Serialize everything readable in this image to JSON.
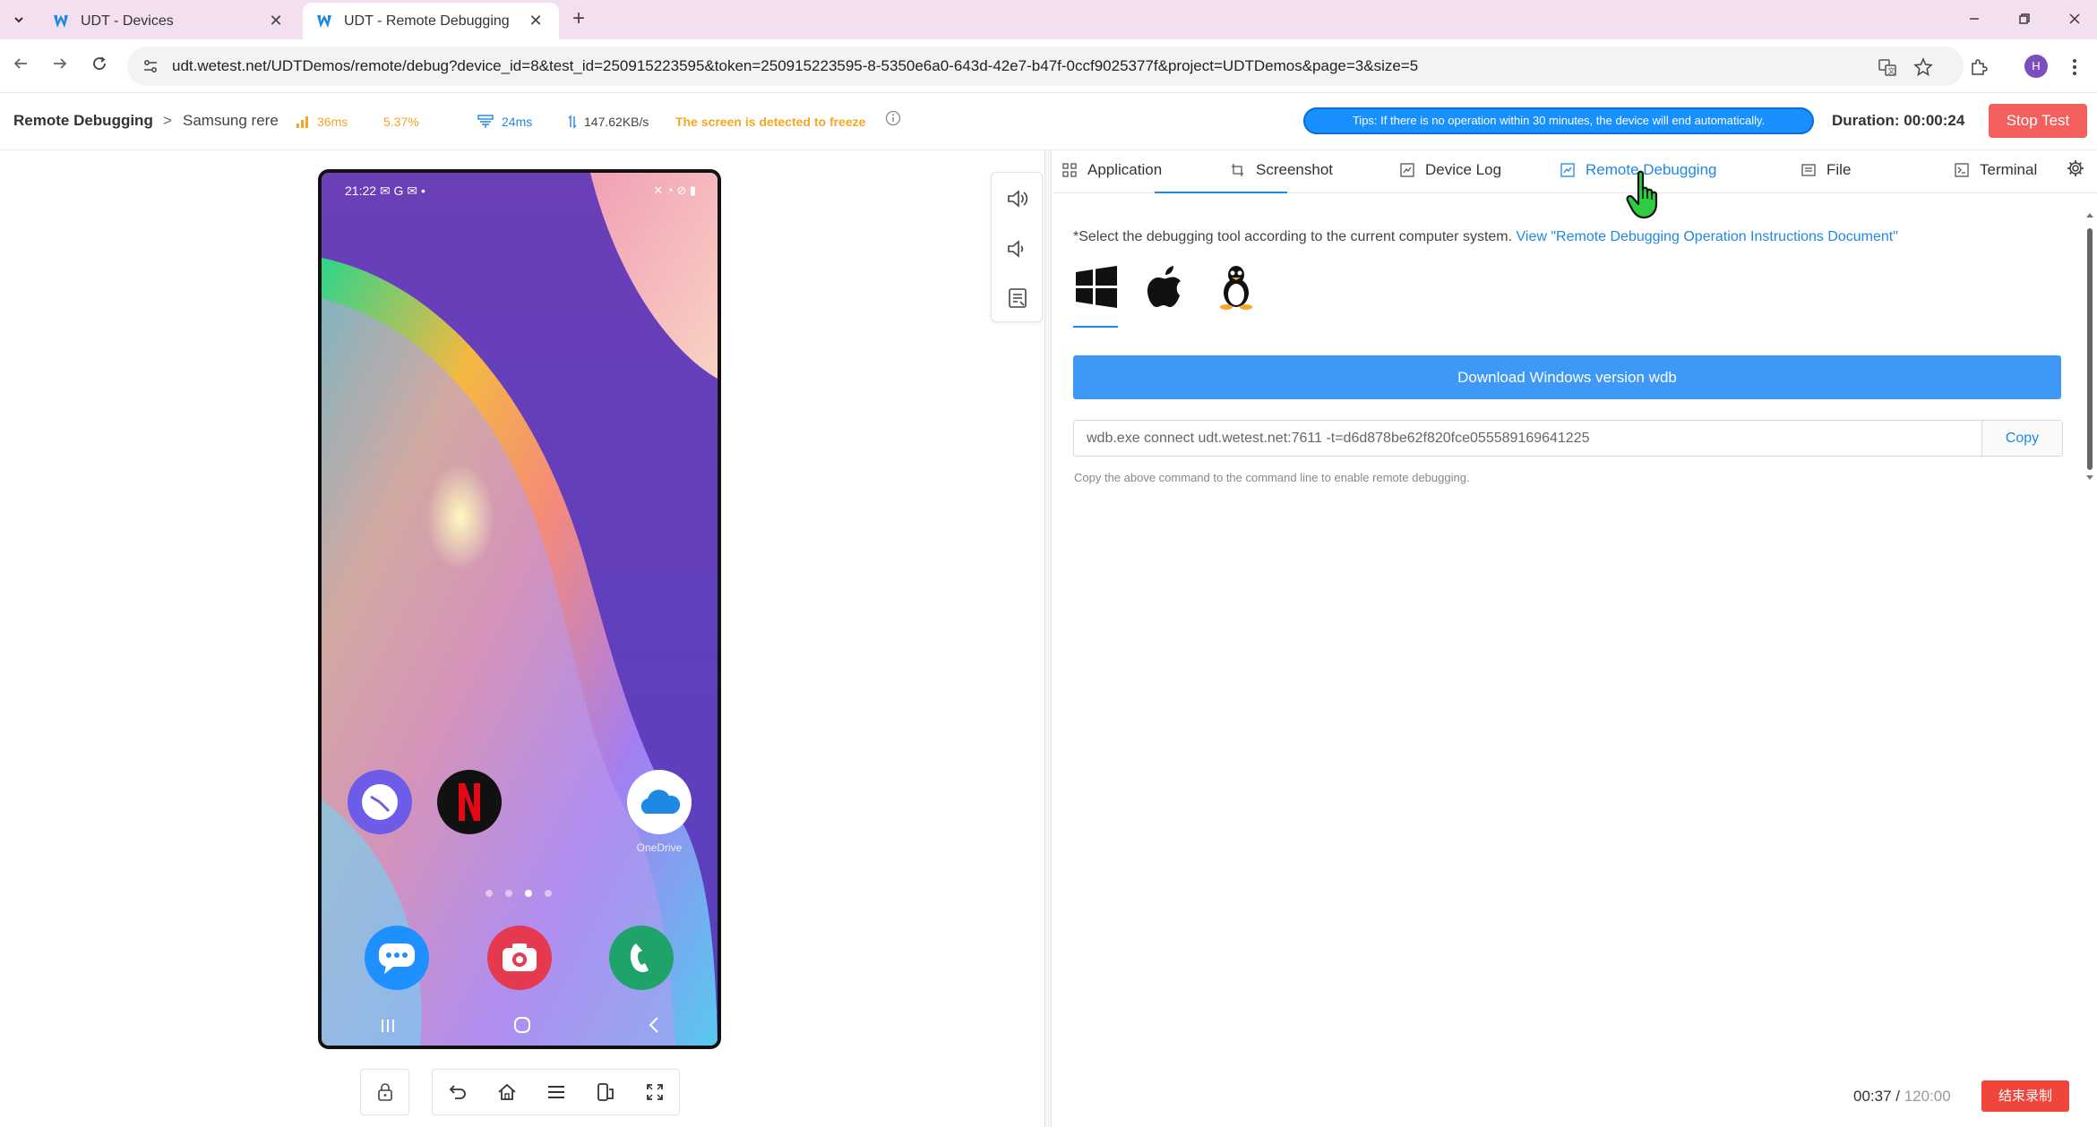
{
  "browser": {
    "tabs": [
      {
        "title": "UDT - Devices"
      },
      {
        "title": "UDT - Remote Debugging"
      }
    ],
    "close_glyph": "✕",
    "new_tab_glyph": "+",
    "url": "udt.wetest.net/UDTDemos/remote/debug?device_id=8&test_id=250915223595&token=250915223595-8-5350e6a0-643d-42e7-b47f-0ccf9025377f&project=UDTDemos&page=3&size=5",
    "profile_initial": "H",
    "accent": "#1e88e5"
  },
  "header": {
    "breadcrumb_root": "Remote Debugging",
    "breadcrumb_sep": ">",
    "device_name": "Samsung rere",
    "latency": "36ms",
    "cpu": "5.37%",
    "net_latency": "24ms",
    "bandwidth": "147.62KB/s",
    "freeze_notice": "The screen is detected to freeze",
    "tips": "Tips: If there is no operation within 30 minutes, the device will end automatically.",
    "duration_label": "Duration:",
    "duration_value": "00:00:24",
    "stop_label": "Stop Test"
  },
  "phone": {
    "time": "21:22",
    "status_icons": "✉ G ✉ •",
    "status_right": "✕ ◔ ⊘ ▮",
    "apps": [
      {
        "name": "",
        "color": "#6c5ce7"
      },
      {
        "name": "",
        "color": "#111111"
      },
      {
        "name": "OneDrive",
        "color": "#ffffff"
      }
    ],
    "dock": [
      {
        "color": "#1e90ff"
      },
      {
        "color": "#e53950"
      },
      {
        "color": "#1fa36a"
      }
    ]
  },
  "right_panel": {
    "tabs": [
      {
        "label": "Application"
      },
      {
        "label": "Screenshot"
      },
      {
        "label": "Device Log"
      },
      {
        "label": "Remote Debugging"
      },
      {
        "label": "File"
      },
      {
        "label": "Terminal"
      }
    ],
    "active_tab": "Remote Debugging",
    "instruction": "*Select the debugging tool according to the current computer system.",
    "instruction_link": "View \"Remote Debugging Operation Instructions Document\"",
    "os_options": [
      "windows-icon",
      "apple-icon",
      "linux-icon"
    ],
    "download_label": "Download Windows version wdb",
    "command": "wdb.exe connect udt.wetest.net:7611 -t=d6d878be62f820fce055589169641225",
    "copy_label": "Copy",
    "hint": "Copy the above command to the command line to enable remote debugging."
  },
  "recording": {
    "elapsed": "00:37",
    "separator": " / ",
    "total": "120:00",
    "stop_label": "结束录制"
  }
}
